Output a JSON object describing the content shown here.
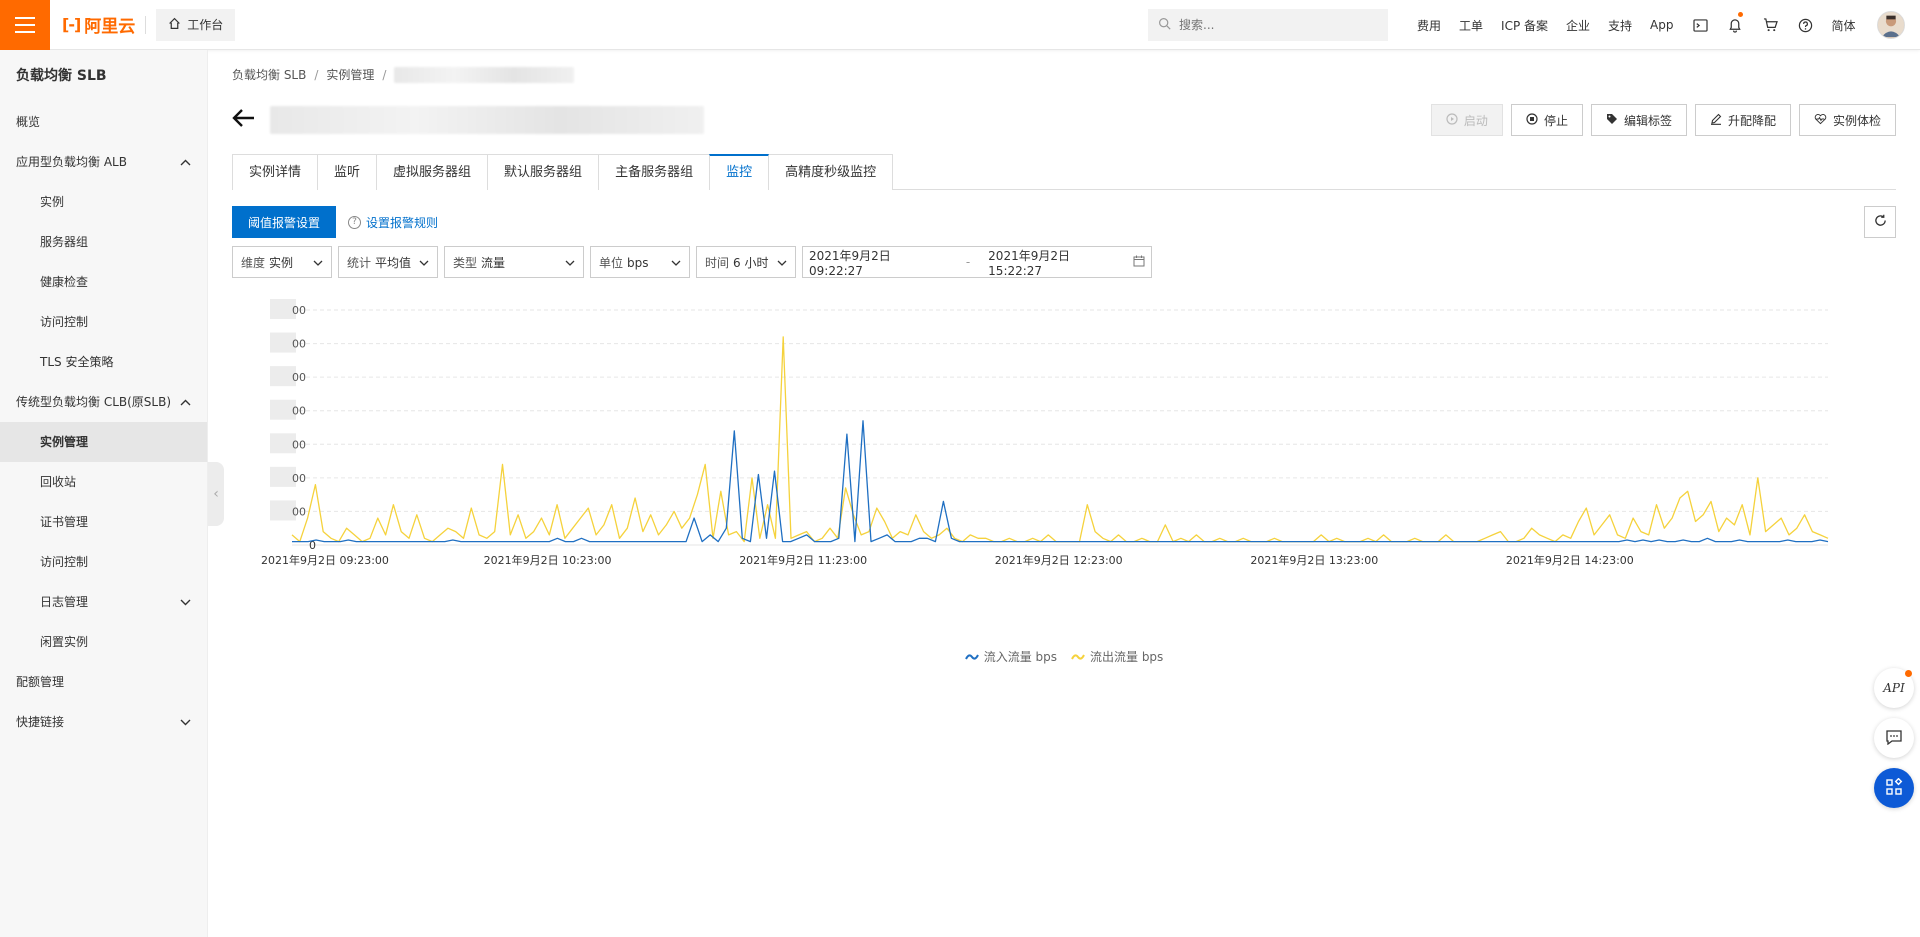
{
  "topbar": {
    "brand": "阿里云",
    "workbench": "工作台",
    "search_placeholder": "搜索...",
    "links": [
      "费用",
      "工单",
      "ICP 备案",
      "企业",
      "支持",
      "App"
    ],
    "lang": "简体"
  },
  "sidebar": {
    "title": "负载均衡 SLB",
    "items": [
      {
        "label": "概览",
        "level": 1
      },
      {
        "label": "应用型负载均衡 ALB",
        "level": 1,
        "expandable": "up"
      },
      {
        "label": "实例",
        "level": 2
      },
      {
        "label": "服务器组",
        "level": 2
      },
      {
        "label": "健康检查",
        "level": 2
      },
      {
        "label": "访问控制",
        "level": 2
      },
      {
        "label": "TLS 安全策略",
        "level": 2
      },
      {
        "label": "传统型负载均衡 CLB(原SLB)",
        "level": 1,
        "expandable": "up"
      },
      {
        "label": "实例管理",
        "level": 2,
        "active": true
      },
      {
        "label": "回收站",
        "level": 2
      },
      {
        "label": "证书管理",
        "level": 2
      },
      {
        "label": "访问控制",
        "level": 2
      },
      {
        "label": "日志管理",
        "level": 2,
        "expandable": "down"
      },
      {
        "label": "闲置实例",
        "level": 2
      },
      {
        "label": "配额管理",
        "level": 1
      },
      {
        "label": "快捷链接",
        "level": 1,
        "expandable": "down"
      }
    ]
  },
  "breadcrumb": [
    "负载均衡 SLB",
    "实例管理"
  ],
  "actions": {
    "start": "启动",
    "stop": "停止",
    "edit_tags": "编辑标签",
    "upgrade": "升配降配",
    "health": "实例体检"
  },
  "tabs": [
    "实例详情",
    "监听",
    "虚拟服务器组",
    "默认服务器组",
    "主备服务器组",
    "监控",
    "高精度秒级监控"
  ],
  "active_tab": 5,
  "toolbar": {
    "alarm_button": "阈值报警设置",
    "help_link": "设置报警规则"
  },
  "filters": [
    {
      "label": "维度",
      "value": "实例"
    },
    {
      "label": "统计",
      "value": "平均值"
    },
    {
      "label": "类型",
      "value": "流量"
    },
    {
      "label": "单位",
      "value": "bps"
    },
    {
      "label": "时间",
      "value": "6 小时"
    }
  ],
  "daterange": {
    "start": "2021年9月2日 09:22:27",
    "separator": "-",
    "end": "2021年9月2日 15:22:27"
  },
  "chart_data": {
    "type": "line",
    "x_labels": [
      "2021年9月2日 09:23:00",
      "2021年9月2日 10:23:00",
      "2021年9月2日 11:23:00",
      "2021年9月2日 12:23:00",
      "2021年9月2日 13:23:00",
      "2021年9月2日 14:23:00"
    ],
    "y_tick_labels": [
      "0"
    ],
    "ylim": [
      0,
      7
    ],
    "series": [
      {
        "name": "流入流量 bps",
        "color": "#1f6fc2",
        "values": [
          0.1,
          0.1,
          0.1,
          0.15,
          0.1,
          0.1,
          0.1,
          0.15,
          0.1,
          0.1,
          0.1,
          0.1,
          0.1,
          0.1,
          0.1,
          0.1,
          0.1,
          0.1,
          0.1,
          0.1,
          0.15,
          0.1,
          0.1,
          0.1,
          0.1,
          0.1,
          0.1,
          0.1,
          0.1,
          0.1,
          0.1,
          0.1,
          0.1,
          0.2,
          0.1,
          0.1,
          0.2,
          0.1,
          0.1,
          0.1,
          0.1,
          0.1,
          0.1,
          0.1,
          0.1,
          0.1,
          0.1,
          0.1,
          0.1,
          0.1,
          0.8,
          0.1,
          0.3,
          0.1,
          0.5,
          3.4,
          0.2,
          0.1,
          2.1,
          0.2,
          2.2,
          0.1,
          0.1,
          0.2,
          0.3,
          0.1,
          0.1,
          0.1,
          0.2,
          3.3,
          0.1,
          3.7,
          0.1,
          0.2,
          0.3,
          0.1,
          0.1,
          0.1,
          0.2,
          0.2,
          0.1,
          1.3,
          0.2,
          0.1,
          0.1,
          0.1,
          0.1,
          0.1,
          0.1,
          0.1,
          0.1,
          0.1,
          0.1,
          0.1,
          0.1,
          0.1,
          0.1,
          0.1,
          0.1,
          0.1,
          0.1,
          0.1,
          0.1,
          0.1,
          0.1,
          0.1,
          0.1,
          0.1,
          0.1,
          0.1,
          0.1,
          0.1,
          0.1,
          0.1,
          0.1,
          0.1,
          0.1,
          0.1,
          0.1,
          0.1,
          0.1,
          0.1,
          0.1,
          0.1,
          0.1,
          0.1,
          0.1,
          0.1,
          0.1,
          0.1,
          0.1,
          0.1,
          0.1,
          0.1,
          0.1,
          0.1,
          0.1,
          0.1,
          0.1,
          0.1,
          0.1,
          0.1,
          0.1,
          0.1,
          0.1,
          0.1,
          0.1,
          0.1,
          0.1,
          0.1,
          0.1,
          0.1,
          0.1,
          0.1,
          0.1,
          0.1,
          0.1,
          0.1,
          0.1,
          0.1,
          0.1,
          0.1,
          0.1,
          0.1,
          0.1,
          0.1,
          0.15,
          0.1,
          0.15,
          0.1,
          0.15,
          0.1,
          0.1,
          0.15,
          0.1,
          0.1,
          0.2,
          0.1,
          0.1,
          0.1,
          0.15,
          0.1,
          0.1,
          0.1,
          0.1,
          0.1,
          0.15,
          0.1,
          0.1,
          0.1,
          0.15,
          0.1
        ]
      },
      {
        "name": "流出流量 bps",
        "color": "#f5d23c",
        "values": [
          0.3,
          0.1,
          0.8,
          1.8,
          0.4,
          0.2,
          0.1,
          0.5,
          0.3,
          0.1,
          0.2,
          0.8,
          0.3,
          1.2,
          0.4,
          0.2,
          0.9,
          0.2,
          0.1,
          0.3,
          0.5,
          0.4,
          0.2,
          1.1,
          0.3,
          0.2,
          0.4,
          2.4,
          0.3,
          0.9,
          0.2,
          0.4,
          0.8,
          0.3,
          1.2,
          0.2,
          0.5,
          0.8,
          1.1,
          0.3,
          0.6,
          1.2,
          0.2,
          0.5,
          1.4,
          0.4,
          0.9,
          0.3,
          0.6,
          1.0,
          0.5,
          0.8,
          1.5,
          2.4,
          0.2,
          1.6,
          0.3,
          0.4,
          0.1,
          2.0,
          0.2,
          1.2,
          0.2,
          6.2,
          0.2,
          0.3,
          0.4,
          0.1,
          0.2,
          0.5,
          0.2,
          1.7,
          0.9,
          0.3,
          0.4,
          1.1,
          0.7,
          0.2,
          0.4,
          0.3,
          0.9,
          0.4,
          0.2,
          0.3,
          0.5,
          0.2,
          0.1,
          0.3,
          0.2,
          0.2,
          0.1,
          0.1,
          0.2,
          0.1,
          0.1,
          0.2,
          0.1,
          0.3,
          0.1,
          0.1,
          0.1,
          0.1,
          1.2,
          0.4,
          0.2,
          0.1,
          0.3,
          0.1,
          0.1,
          0.2,
          0.1,
          0.1,
          0.6,
          0.1,
          0.2,
          0.1,
          0.3,
          0.1,
          0.1,
          0.2,
          0.1,
          0.1,
          0.2,
          0.1,
          0.1,
          0.1,
          0.2,
          0.1,
          0.1,
          0.1,
          0.1,
          0.1,
          0.3,
          0.1,
          0.2,
          0.1,
          0.1,
          0.1,
          0.2,
          0.1,
          0.3,
          0.1,
          0.1,
          0.1,
          0.2,
          0.1,
          0.1,
          0.1,
          0.3,
          0.1,
          0.1,
          0.1,
          0.1,
          0.2,
          0.3,
          0.4,
          0.1,
          0.1,
          0.2,
          0.5,
          0.3,
          0.2,
          0.1,
          0.3,
          0.2,
          0.7,
          1.1,
          0.3,
          0.6,
          0.9,
          0.3,
          0.2,
          0.8,
          0.4,
          0.3,
          1.2,
          0.5,
          0.8,
          1.4,
          1.6,
          0.7,
          0.9,
          1.3,
          0.4,
          0.8,
          0.6,
          1.2,
          0.3,
          2.0,
          0.4,
          0.6,
          0.8,
          0.3,
          0.5,
          0.9,
          0.4,
          0.3,
          0.2
        ]
      }
    ],
    "legend_position": "bottom",
    "grid": true
  }
}
